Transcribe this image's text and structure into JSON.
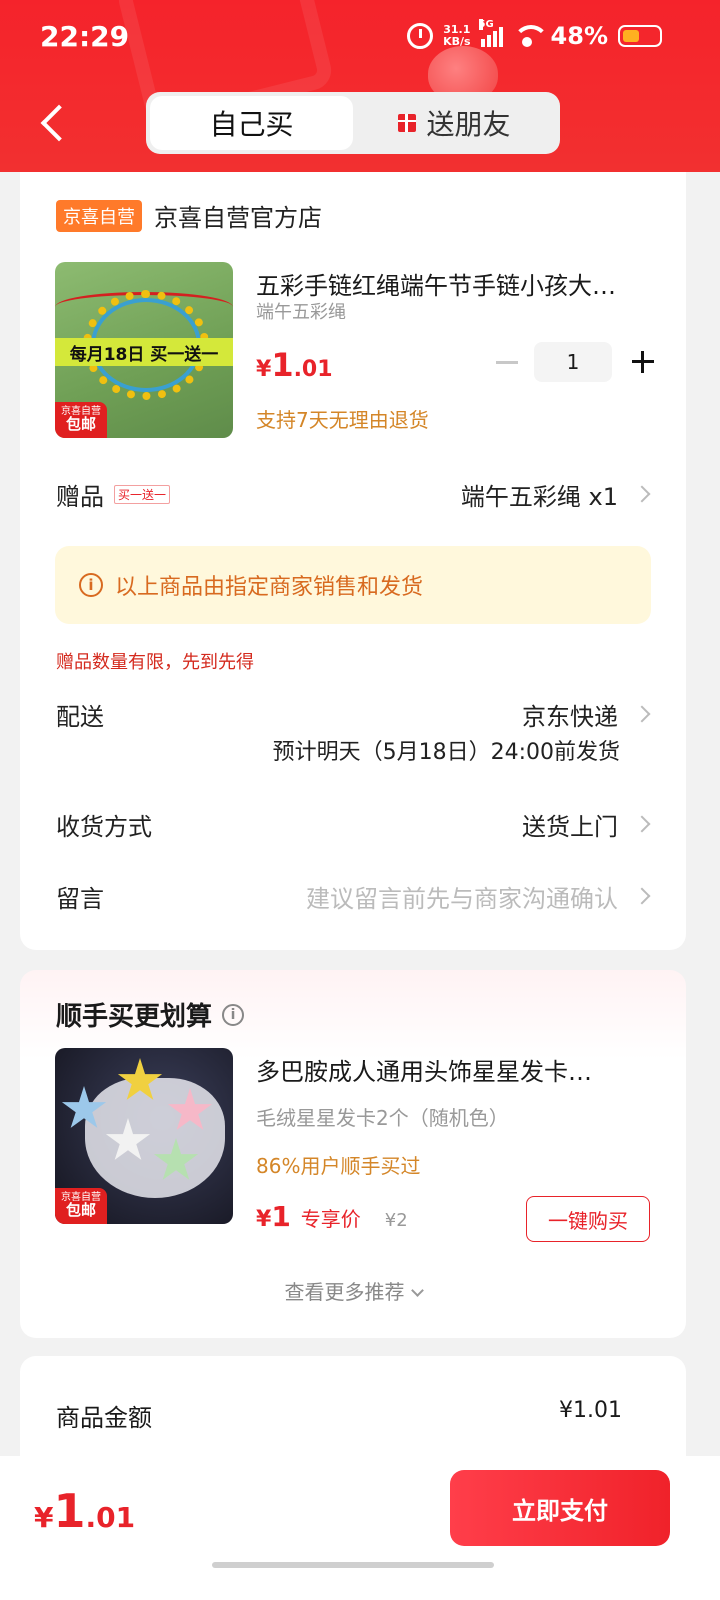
{
  "status_bar": {
    "time": "22:29",
    "net_speed_value": "31.1",
    "net_speed_unit": "KB/s",
    "network": "5G",
    "battery": "48%"
  },
  "header": {
    "tabs": [
      "自己买",
      "送朋友"
    ],
    "active_tab": "自己买"
  },
  "store": {
    "tag": "京喜自营",
    "name": "京喜自营官方店"
  },
  "product": {
    "title": "五彩手链红绳端午节手链小孩大…",
    "spec": "端午五彩绳",
    "image_banner": "每月18日 买一送一",
    "badge_top": "京喜自营",
    "badge_bottom": "包邮",
    "price_symbol": "¥",
    "price_int": "1",
    "price_dec": ".01",
    "quantity": "1",
    "return_policy": "支持7天无理由退货"
  },
  "gift": {
    "label": "赠品",
    "tag": "买一送一",
    "value": "端午五彩绳  x1"
  },
  "notice": {
    "icon": "i",
    "text": "以上商品由指定商家销售和发货"
  },
  "limit_note": "赠品数量有限，先到先得",
  "delivery": {
    "label": "配送",
    "value": "京东快递",
    "estimate": "预计明天（5月18日）24:00前发货"
  },
  "receive": {
    "label": "收货方式",
    "value": "送货上门"
  },
  "message": {
    "label": "留言",
    "placeholder": "建议留言前先与商家沟通确认"
  },
  "recommend": {
    "title": "顺手买更划算",
    "info_icon": "i",
    "item": {
      "title": "多巴胺成人通用头饰星星发卡…",
      "spec": "毛绒星星发卡2个（随机色）",
      "stat": "86%用户顺手买过",
      "price_symbol": "¥",
      "price": "1",
      "price_label": "专享价",
      "orig_price": "¥2",
      "buy_label": "一键购买",
      "badge_top": "京喜自营",
      "badge_bottom": "包邮"
    },
    "more_label": "查看更多推荐"
  },
  "summary": {
    "label": "商品金额",
    "value": "¥1.01"
  },
  "footer": {
    "price_symbol": "¥",
    "price_int": "1",
    "price_dec": ".01",
    "pay_label": "立即支付"
  },
  "colors": {
    "brand_red": "#f23030",
    "price_red": "#e8232a",
    "orange": "#d48628",
    "tag_orange": "#ff7a2a"
  }
}
